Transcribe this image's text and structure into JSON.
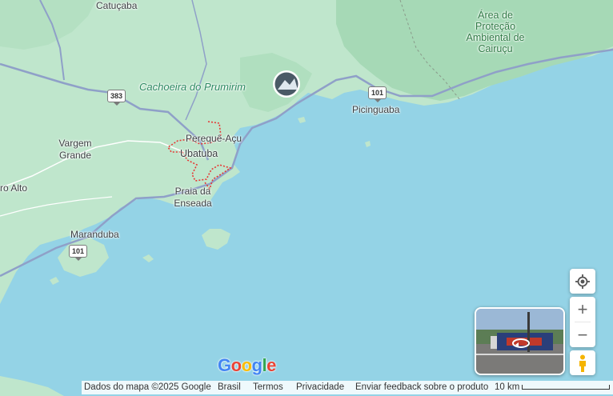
{
  "map": {
    "labels": {
      "catucaba": "Catuçaba",
      "cachoeira": "Cachoeira do Prumirim",
      "vargem_grande": "Vargem Grande",
      "rio_alto": "ro Alto",
      "pereque_acu": "Perequê-Açu",
      "ubatuba": "Ubatuba",
      "praia_enseada": "Praia da Enseada",
      "maranduba": "Maranduba",
      "picinguaba": "Picinguaba",
      "area_protecao": "Área de Proteção Ambiental de Cairuçu"
    },
    "road_shields": [
      "383",
      "101",
      "101"
    ]
  },
  "controls": {
    "zoom_in": "+",
    "zoom_out": "−",
    "location_icon": "my-location-icon",
    "pegman_icon": "pegman-icon"
  },
  "footer": {
    "map_data": "Dados do mapa ©2025 Google",
    "country": "Brasil",
    "terms": "Termos",
    "privacy": "Privacidade",
    "feedback": "Enviar feedback sobre o produto",
    "scale": "10 km"
  },
  "logo": {
    "g1": "G",
    "o1": "o",
    "o2": "o",
    "g2": "g",
    "l": "l",
    "e": "e"
  },
  "colors": {
    "water": "#94d3e6",
    "land": "#bfe6cc",
    "forest": "#a6d9b6",
    "road": "#8fa0c8"
  }
}
